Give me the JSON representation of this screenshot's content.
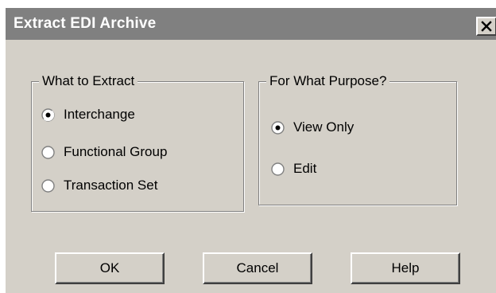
{
  "window": {
    "title": "Extract EDI Archive",
    "close_icon": "close-icon"
  },
  "what_to_extract": {
    "legend": "What to Extract",
    "options": [
      {
        "label": "Interchange",
        "checked": true
      },
      {
        "label": "Functional Group",
        "checked": false
      },
      {
        "label": "Transaction Set",
        "checked": false
      }
    ]
  },
  "purpose": {
    "legend": "For What Purpose?",
    "options": [
      {
        "label": "View Only",
        "checked": true
      },
      {
        "label": "Edit",
        "checked": false
      }
    ]
  },
  "buttons": {
    "ok": "OK",
    "cancel": "Cancel",
    "help": "Help"
  }
}
